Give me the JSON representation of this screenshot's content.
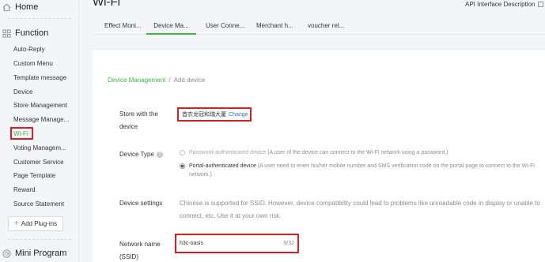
{
  "sidebar": {
    "home": "Home",
    "function": "Function",
    "items": [
      "Auto-Reply",
      "Custom Menu",
      "Template message",
      "Device",
      "Store Management",
      "Message Manage...",
      "Wi-Fi",
      "Voting Managem...",
      "Customer Service",
      "Page Template",
      "Reward",
      "Source Statement"
    ],
    "add_plugins": "Add Plug-ins",
    "mini_program": "Mini Program"
  },
  "header": {
    "title": "Wi-Fi",
    "api_link": "API Interface Description"
  },
  "tabs": [
    "Effect Moni...",
    "Device Ma...",
    "User Conne...",
    "Merchant h...",
    "voucher rel..."
  ],
  "breadcrumb": {
    "parent": "Device Management",
    "separator": "/",
    "current": "Add device"
  },
  "form": {
    "store_label_1": "Store with the",
    "store_label_2": "device",
    "store_name": "首农龙冠和瑞大厦",
    "change": "Change",
    "device_type_label": "Device Type",
    "option_password_title": "Password-authenticated device",
    "option_password_desc": " (A user of the device can connect to the Wi-Fi network using a password.)",
    "option_portal_title": "Portal-authenticated device",
    "option_portal_desc": " (A user need to enter his/her mobile number and SMS verification code on the portal page to connect to the Wi-Fi network.)",
    "device_settings_label": "Device settings",
    "settings_note": "Chinese is supported for SSID. However, device compatibility could lead to problems like unreadable code in display or unable to connect, etc. Use it at your own risk.",
    "network_label_1": "Network name",
    "network_label_2": "(SSID)",
    "ssid_value": "h3c-oasis",
    "ssid_count": "9/32"
  },
  "colors": {
    "accent": "#44b549",
    "highlight": "#d71f1f",
    "link": "#2e74b5"
  }
}
